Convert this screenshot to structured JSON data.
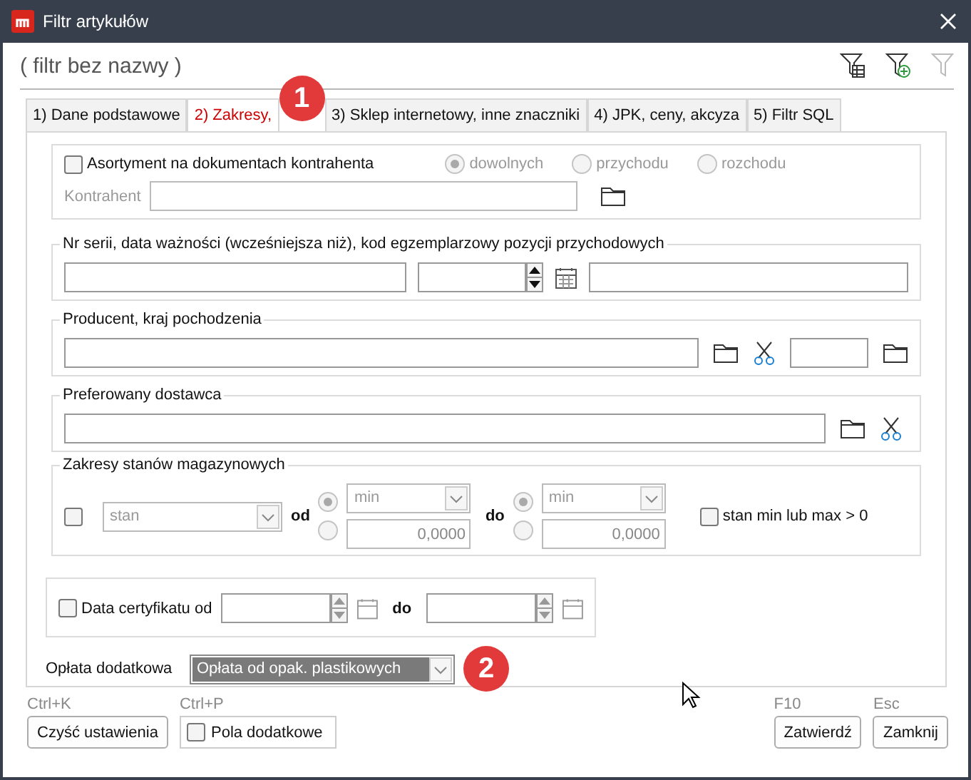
{
  "window": {
    "title": "Filtr artykułów"
  },
  "filter_name": "( filtr bez nazwy )",
  "tabs": [
    {
      "label": "1) Dane podstawowe",
      "selected": false
    },
    {
      "label": "2) Zakresy,",
      "selected": true
    },
    {
      "label": "3) Sklep internetowy, inne znaczniki",
      "selected": false
    },
    {
      "label": "4) JPK, ceny, akcyza",
      "selected": false
    },
    {
      "label": "5) Filtr SQL",
      "selected": false
    }
  ],
  "contractor": {
    "checkbox": {
      "label": "Asortyment na dokumentach kontrahenta",
      "checked": false
    },
    "radios": [
      {
        "label": "dowolnych",
        "selected": true
      },
      {
        "label": "przychodu",
        "selected": false
      },
      {
        "label": "rozchodu",
        "selected": false
      }
    ],
    "field_label": "Kontrahent"
  },
  "serial": {
    "legend": "Nr serii, data ważności (wcześniejsza niż), kod egzemplarzowy pozycji przychodowych"
  },
  "producer": {
    "legend": "Producent, kraj pochodzenia"
  },
  "supplier": {
    "legend": "Preferowany dostawca"
  },
  "stock": {
    "legend": "Zakresy stanów magazynowych",
    "checked": false,
    "combo": "stan",
    "bounds": [
      {
        "label": "od",
        "mode": "min",
        "value": "0,0000",
        "min_selected": true
      },
      {
        "label": "do",
        "mode": "min",
        "value": "0,0000",
        "min_selected": true
      }
    ],
    "extra": {
      "label": "stan min lub max > 0",
      "checked": false
    }
  },
  "certificate": {
    "label": "Data certyfikatu od",
    "checked": false,
    "to_label": "do"
  },
  "fee": {
    "label": "Opłata dodatkowa",
    "value": "Opłata od opak. plastikowych"
  },
  "footer": [
    {
      "shortcut": "Ctrl+K",
      "label": "Czyść ustawienia",
      "kind": "button"
    },
    {
      "shortcut": "Ctrl+P",
      "label": "Pola dodatkowe",
      "kind": "checkbox",
      "checked": false
    },
    {
      "shortcut": "F10",
      "label": "Zatwierdź",
      "kind": "button"
    },
    {
      "shortcut": "Esc",
      "label": "Zamknij",
      "kind": "button"
    }
  ],
  "badges": [
    "1",
    "2"
  ]
}
